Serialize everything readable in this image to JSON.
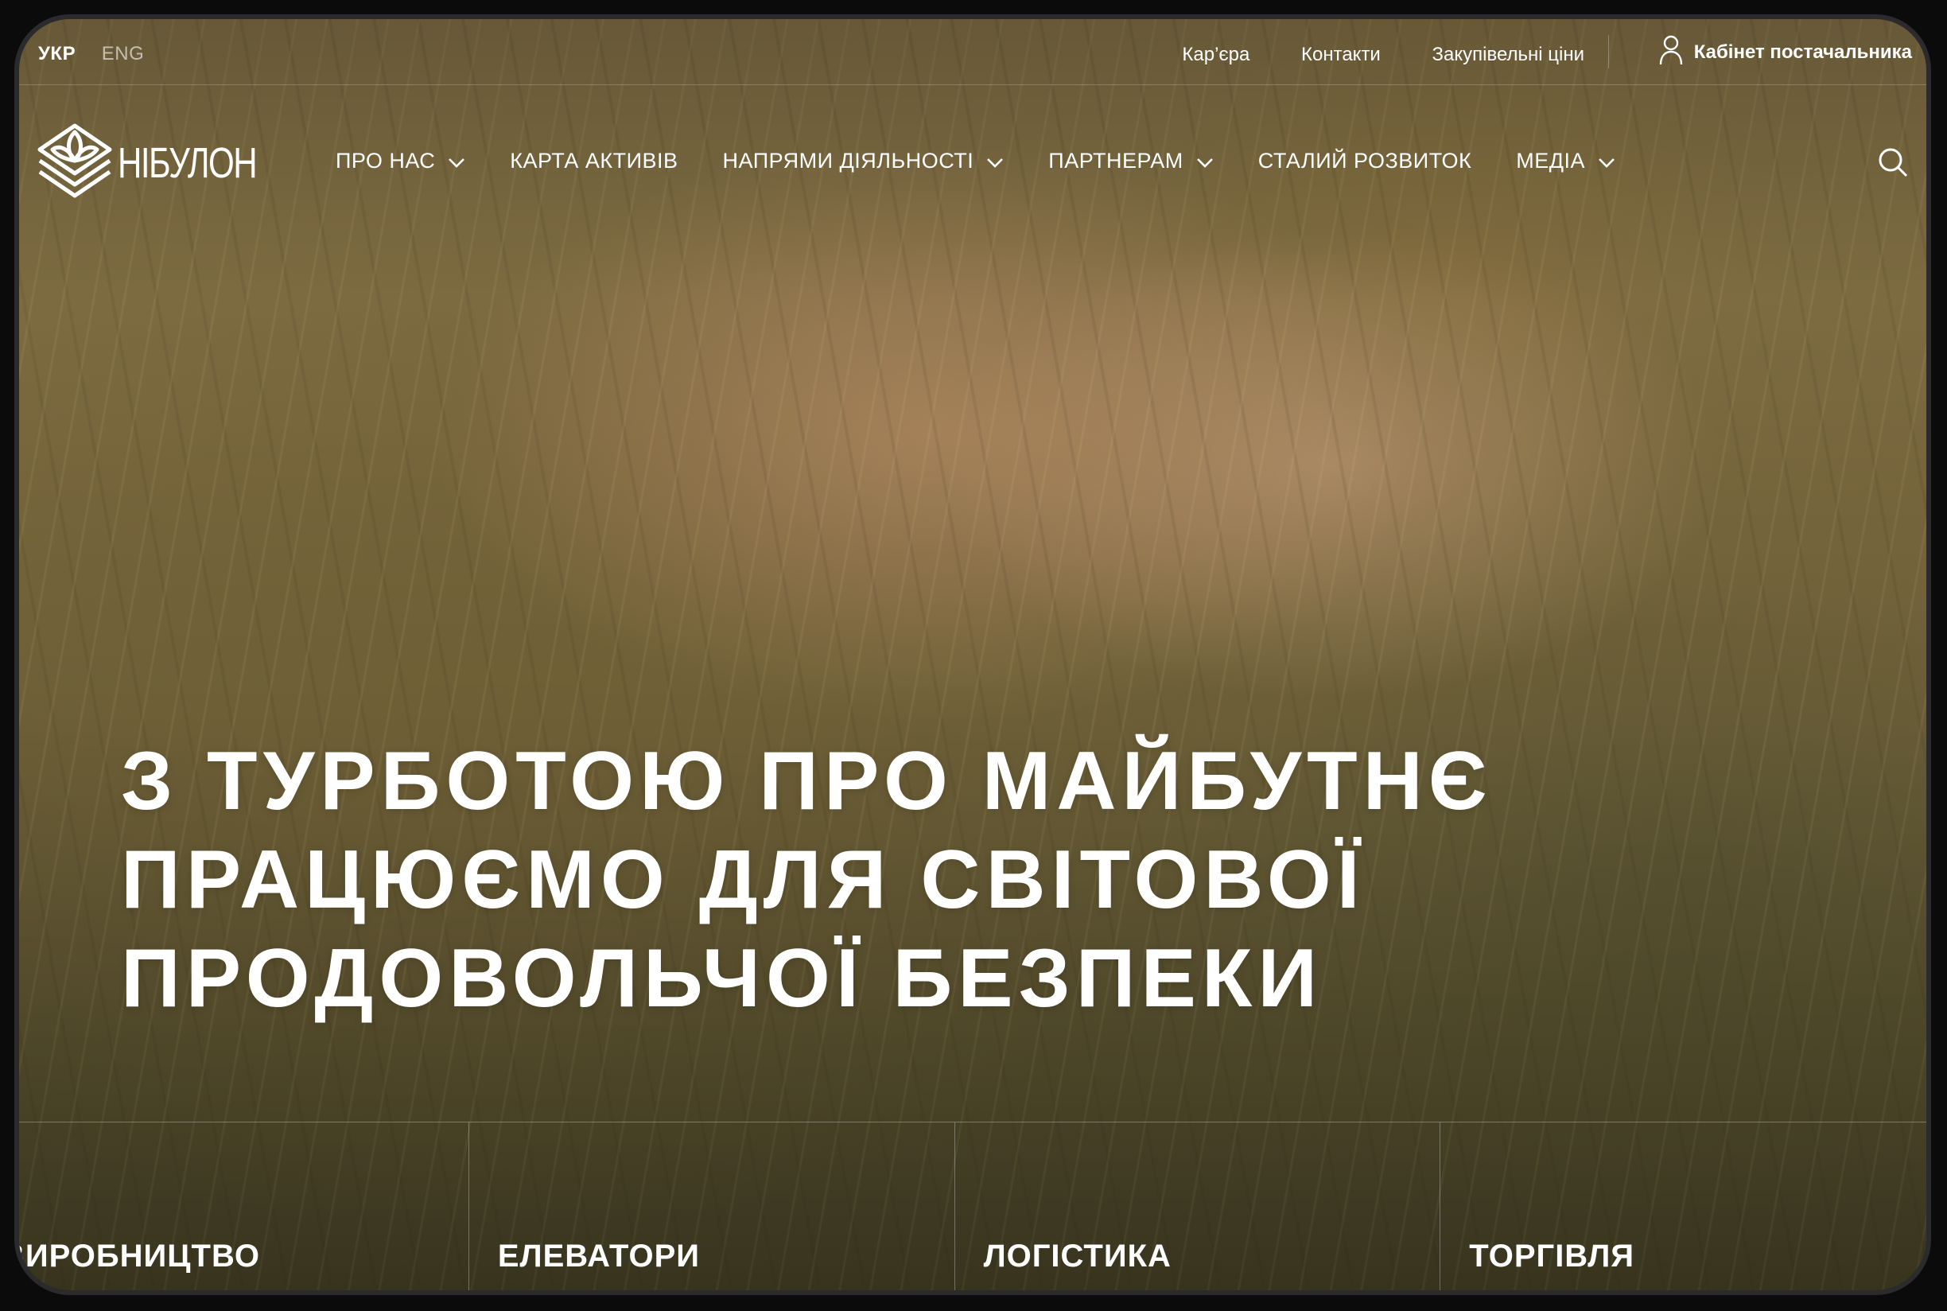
{
  "language": {
    "active": "УКР",
    "other": "ENG"
  },
  "utility_links": [
    {
      "label": "Кар’єра"
    },
    {
      "label": "Контакти"
    },
    {
      "label": "Закупівельні ціни"
    }
  ],
  "supplier_cabinet": {
    "label": "Кабінет постачальника",
    "icon": "user-icon"
  },
  "logo": {
    "text": "НІБУЛОН",
    "icon": "nibulon-logo-icon"
  },
  "nav": {
    "items": [
      {
        "label": "ПРО НАС",
        "has_dropdown": true
      },
      {
        "label": "КАРТА АКТИВІВ",
        "has_dropdown": false
      },
      {
        "label": "НАПРЯМИ ДІЯЛЬНОСТІ",
        "has_dropdown": true
      },
      {
        "label": "ПАРТНЕРАМ",
        "has_dropdown": true
      },
      {
        "label": "СТАЛИЙ РОЗВИТОК",
        "has_dropdown": false
      },
      {
        "label": "МЕДІА",
        "has_dropdown": true
      }
    ],
    "search_icon": "search-icon"
  },
  "hero": {
    "headline_lines": [
      "З ТУРБОТОЮ ПРО МАЙБУТНЄ",
      "ПРАЦЮЄМО ДЛЯ СВІТОВОЇ",
      "ПРОДОВОЛЬЧОЇ БЕЗПЕКИ"
    ]
  },
  "categories": [
    {
      "label": "ВИРОБНИЦТВО"
    },
    {
      "label": "ЕЛЕВАТОРИ"
    },
    {
      "label": "ЛОГІСТИКА"
    },
    {
      "label": "ТОРГІВЛЯ"
    }
  ],
  "colors": {
    "text": "#ffffff",
    "bezel": "#0b0b0c"
  }
}
